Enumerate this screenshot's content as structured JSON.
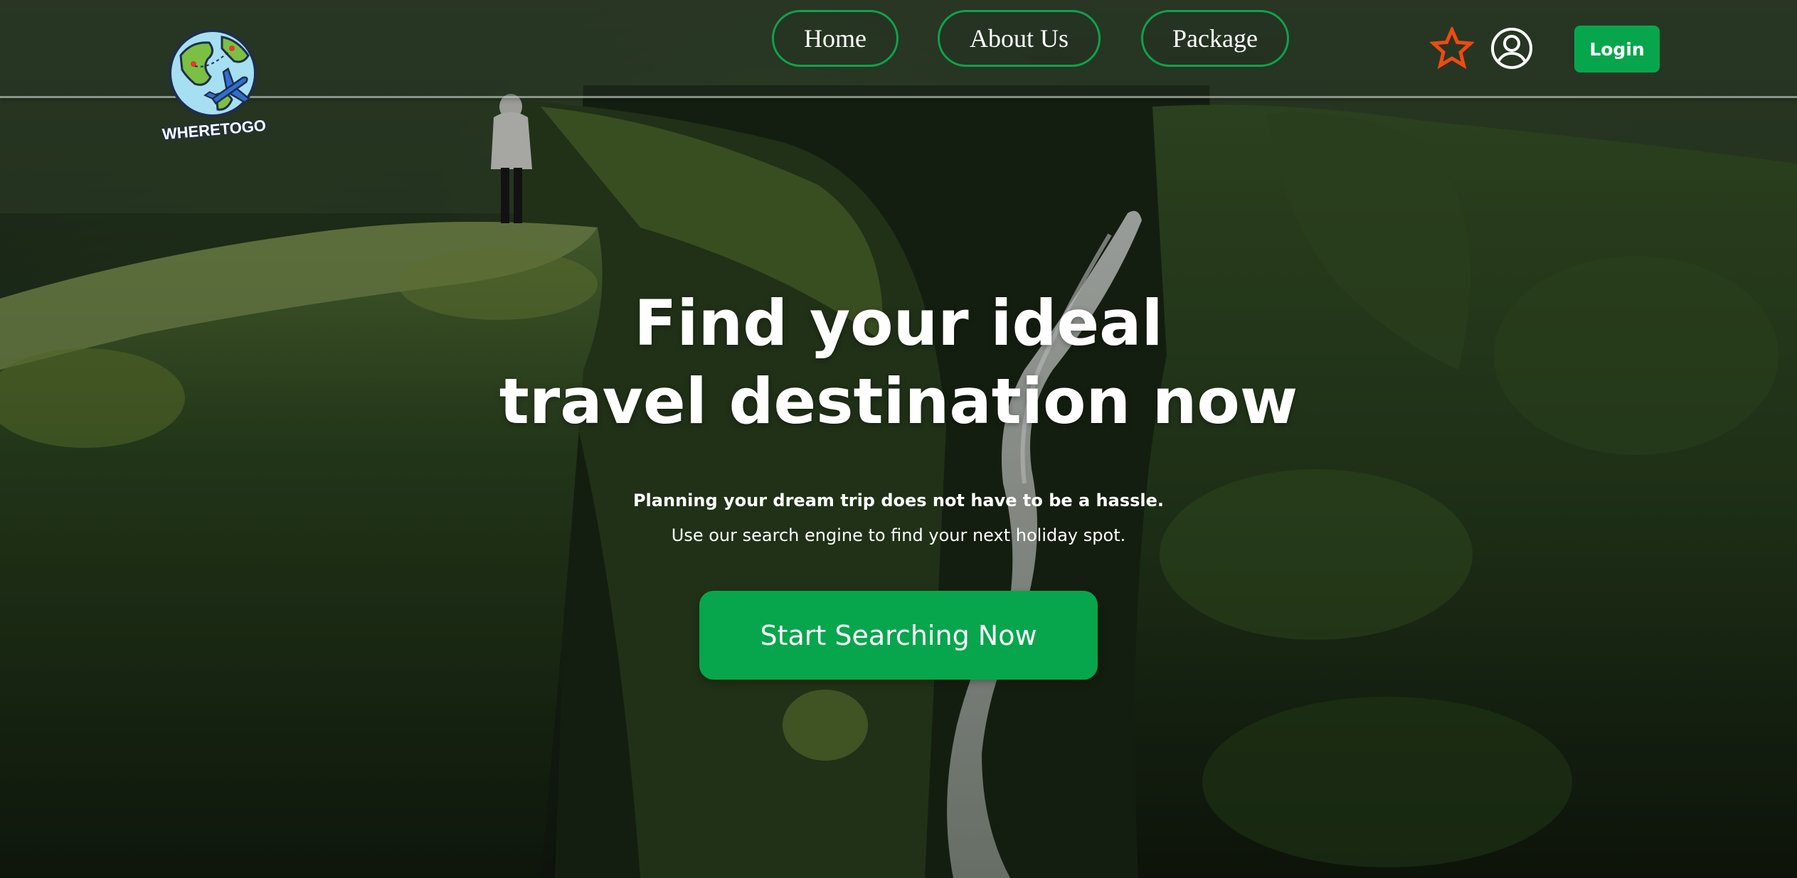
{
  "colors": {
    "accent_green": "#07a64c",
    "nav_border_green": "#0fa24c",
    "star_orange": "#ef4a12",
    "text_white": "#ffffff"
  },
  "header": {
    "logo": {
      "text": "WHERETOGO",
      "icon": "globe-airplane-icon"
    },
    "nav": [
      {
        "label": "Home"
      },
      {
        "label": "About Us"
      },
      {
        "label": "Package"
      }
    ],
    "icons": {
      "favorites": "star-icon",
      "profile": "user-circle-icon"
    },
    "login_label": "Login"
  },
  "hero": {
    "title_line1": "Find your ideal",
    "title_line2": "travel destination now",
    "subtitle_line1": "Planning your dream trip does not have to be a hassle.",
    "subtitle_line2": "Use our search engine to find your next holiday spot.",
    "cta_label": "Start Searching Now"
  }
}
